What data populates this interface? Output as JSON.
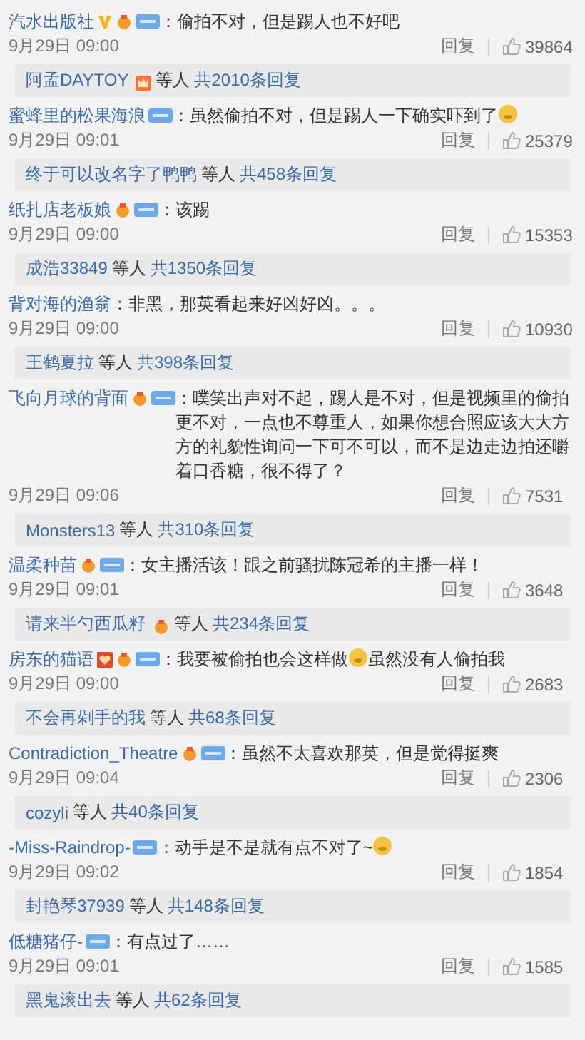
{
  "comments": [
    {
      "user": "汽水出版社",
      "badges": [
        {
          "kind": "v"
        },
        {
          "kind": "medal"
        },
        {
          "kind": "tag"
        }
      ],
      "segments": [
        {
          "kind": "text",
          "text": "：偷拍不对，但是踢人也不好吧"
        }
      ],
      "date": "9月29日 09:00",
      "reply": "回复",
      "likes": "39864",
      "thread": {
        "user": "阿孟DAYTOY",
        "badges": [
          {
            "kind": "crown"
          }
        ],
        "others": "等人",
        "total": "共2010条回复"
      }
    },
    {
      "user": "蜜蜂里的松果海浪",
      "badges": [
        {
          "kind": "tag"
        }
      ],
      "segments": [
        {
          "kind": "text",
          "text": "：虽然偷拍不对，但是踢人一下确实吓到了"
        },
        {
          "kind": "emoji"
        }
      ],
      "date": "9月29日 09:01",
      "reply": "回复",
      "likes": "25379",
      "thread": {
        "user": "终于可以改名字了鸭鸭",
        "others": "等人",
        "total": "共458条回复"
      }
    },
    {
      "user": "纸扎店老板娘",
      "badges": [
        {
          "kind": "medal"
        },
        {
          "kind": "tag"
        }
      ],
      "segments": [
        {
          "kind": "text",
          "text": "：该踢"
        }
      ],
      "date": "9月29日 09:00",
      "reply": "回复",
      "likes": "15353",
      "thread": {
        "user": "成浩33849",
        "others": "等人",
        "total": "共1350条回复"
      }
    },
    {
      "user": "背对海的渔翁",
      "segments": [
        {
          "kind": "text",
          "text": "：非黑，那英看起来好凶好凶。。。"
        }
      ],
      "date": "9月29日 09:00",
      "reply": "回复",
      "likes": "10930",
      "thread": {
        "user": "王鹤夏拉",
        "others": "等人",
        "total": "共398条回复"
      }
    },
    {
      "user": "飞向月球的背面",
      "badges": [
        {
          "kind": "medal"
        },
        {
          "kind": "tag"
        }
      ],
      "segments": [
        {
          "kind": "text",
          "text": "：噗笑出声对不起，踢人是不对，但是视频里的偷拍更不对，一点也不尊重人，如果你想合照应该大大方方的礼貌性询问一下可不可以，而不是边走边拍还嚼着口香糖，很不得了？"
        }
      ],
      "date": "9月29日 09:06",
      "reply": "回复",
      "likes": "7531",
      "thread": {
        "user": "Monsters13",
        "others": "等人",
        "total": "共310条回复"
      }
    },
    {
      "user": "温柔种苗",
      "badges": [
        {
          "kind": "medal"
        },
        {
          "kind": "tag"
        }
      ],
      "segments": [
        {
          "kind": "text",
          "text": "：女主播活该！跟之前骚扰陈冠希的主播一样！"
        }
      ],
      "date": "9月29日 09:01",
      "reply": "回复",
      "likes": "3648",
      "thread": {
        "user": "请来半勺西瓜籽",
        "badges": [
          {
            "kind": "medal"
          }
        ],
        "others": "等人",
        "total": "共234条回复"
      }
    },
    {
      "user": "房东的猫语",
      "badges": [
        {
          "kind": "heart"
        },
        {
          "kind": "medal"
        },
        {
          "kind": "tag"
        }
      ],
      "segments": [
        {
          "kind": "text",
          "text": "：我要被偷拍也会这样做"
        },
        {
          "kind": "emoji"
        },
        {
          "kind": "text",
          "text": "虽然没有人偷拍我"
        }
      ],
      "date": "9月29日 09:00",
      "reply": "回复",
      "likes": "2683",
      "thread": {
        "user": "不会再剁手的我",
        "others": "等人",
        "total": "共68条回复"
      }
    },
    {
      "user": "Contradiction_Theatre",
      "badges": [
        {
          "kind": "medal"
        },
        {
          "kind": "tag"
        }
      ],
      "segments": [
        {
          "kind": "text",
          "text": "：虽然不太喜欢那英，但是觉得挺爽"
        }
      ],
      "date": "9月29日 09:04",
      "reply": "回复",
      "likes": "2306",
      "thread": {
        "user": "cozyli",
        "others": "等人",
        "total": "共40条回复"
      }
    },
    {
      "user": "-Miss-Raindrop-",
      "badges": [
        {
          "kind": "tag"
        }
      ],
      "segments": [
        {
          "kind": "text",
          "text": "：动手是不是就有点不对了~"
        },
        {
          "kind": "emoji"
        }
      ],
      "date": "9月29日 09:02",
      "reply": "回复",
      "likes": "1854",
      "thread": {
        "user": "封艳琴37939",
        "others": "等人",
        "total": "共148条回复"
      }
    },
    {
      "user": "低糖猪仔-",
      "badges": [
        {
          "kind": "tag"
        }
      ],
      "segments": [
        {
          "kind": "text",
          "text": "：有点过了……"
        }
      ],
      "date": "9月29日 09:01",
      "reply": "回复",
      "likes": "1585",
      "thread": {
        "user": "黑鬼滚出去",
        "others": "等人",
        "total": "共62条回复"
      }
    }
  ]
}
